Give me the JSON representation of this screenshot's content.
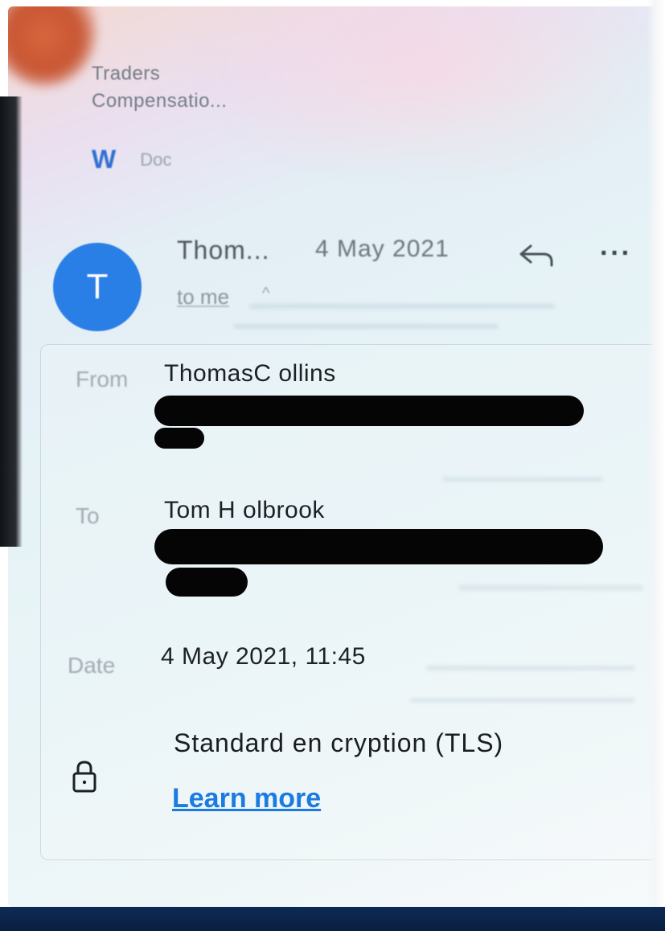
{
  "previous_message": {
    "line1": "Traders",
    "line2": "Compensatio...",
    "attachment_icon": "W",
    "attachment_label": "Doc"
  },
  "sender": {
    "avatar_initial": "T",
    "name": "Thom...",
    "date": "4 May 2021",
    "recipient_summary": "to me",
    "caret": "^",
    "more": "···"
  },
  "details": {
    "from_label": "From",
    "from_name": "ThomasC ollins",
    "to_label": "To",
    "to_name": "Tom H olbrook",
    "date_label": "Date",
    "date_value": "4  May  2021, 11:45",
    "encryption_text": "Standard en cryption (TLS)",
    "learn_more": "Learn more"
  },
  "colors": {
    "avatar": "#2a7fe6",
    "link": "#1b7be0",
    "redaction": "#050505"
  },
  "icons": {
    "attachment": "word-icon",
    "reply": "reply-icon",
    "more": "more-icon",
    "lock": "lock-icon"
  }
}
